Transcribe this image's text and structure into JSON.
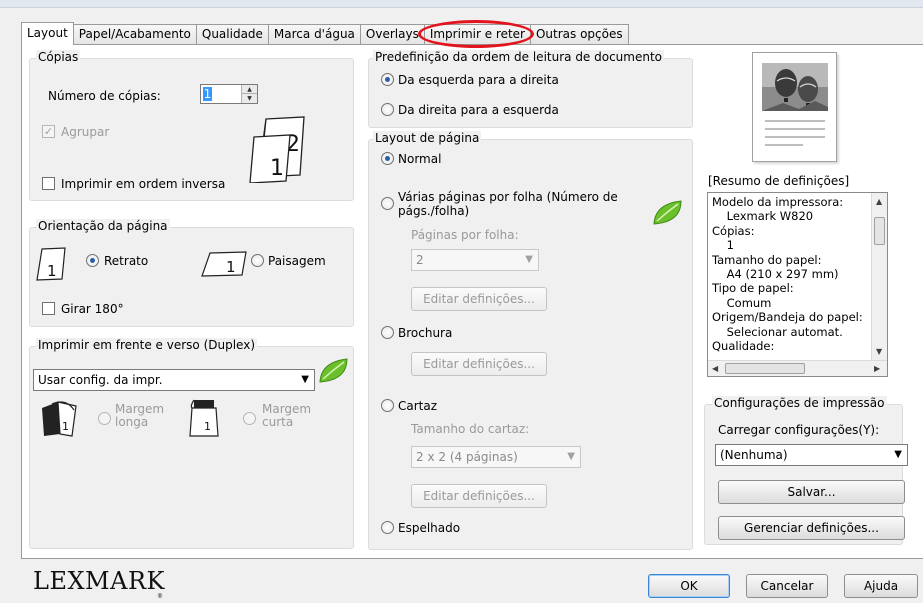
{
  "tabs": [
    {
      "label": "Layout"
    },
    {
      "label": "Papel/Acabamento"
    },
    {
      "label": "Qualidade"
    },
    {
      "label": "Marca d'água"
    },
    {
      "label": "Overlays"
    },
    {
      "label": "Imprimir e reter"
    },
    {
      "label": "Outras opções"
    }
  ],
  "copies": {
    "group_title": "Cópias",
    "count_label": "Número de cópias:",
    "count_value": "1",
    "collate_label": "Agrupar",
    "reverse_label": "Imprimir em ordem inversa"
  },
  "orientation": {
    "group_title": "Orientação da página",
    "portrait_label": "Retrato",
    "landscape_label": "Paisagem",
    "rotate_label": "Girar 180°"
  },
  "duplex": {
    "group_title": "Imprimir em frente e verso (Duplex)",
    "selected": "Usar config. da impr.",
    "long_edge_label": "Margem\nlonga",
    "short_edge_label": "Margem\ncurta"
  },
  "reading_order": {
    "group_title": "Predefinição da ordem de leitura de documento",
    "ltr_label": "Da esquerda para a direita",
    "rtl_label": "Da direita para a esquerda"
  },
  "page_layout": {
    "group_title": "Layout de página",
    "normal_label": "Normal",
    "multi_label": "Várias páginas por folha (Número de págs./folha)",
    "pages_per_sheet_label": "Páginas por folha:",
    "pages_per_sheet_value": "2",
    "edit_settings_label": "Editar definições...",
    "brochure_label": "Brochura",
    "poster_label": "Cartaz",
    "poster_size_label": "Tamanho do cartaz:",
    "poster_size_value": "2 x 2 (4 páginas)",
    "mirror_label": "Espelhado"
  },
  "summary": {
    "title": "[Resumo de definições]",
    "text": "Modelo da impressora:\n    Lexmark W820\nCópias:\n    1\nTamanho do papel:\n    A4 (210 x 297 mm)\nTipo de papel:\n    Comum\nOrigem/Bandeja do papel:\n    Selecionar automat.\nQualidade:"
  },
  "print_config": {
    "group_title": "Configurações de impressão",
    "load_label": "Carregar configurações(Y):",
    "load_value": "(Nenhuma)",
    "save_label": "Salvar...",
    "manage_label": "Gerenciar definições..."
  },
  "footer": {
    "brand": "LEXMARK",
    "trademark": "®",
    "ok_label": "OK",
    "cancel_label": "Cancelar",
    "help_label": "Ajuda"
  },
  "colors": {
    "highlight": "#e2141d",
    "radio_dot": "#2a5fa8",
    "leaf": "#6bbf2a"
  },
  "icons": [
    "leaf-icon",
    "page-copies-icon",
    "portrait-page-icon",
    "landscape-page-icon",
    "duplex-long-edge-icon",
    "duplex-short-edge-icon",
    "balloon-preview-icon"
  ]
}
